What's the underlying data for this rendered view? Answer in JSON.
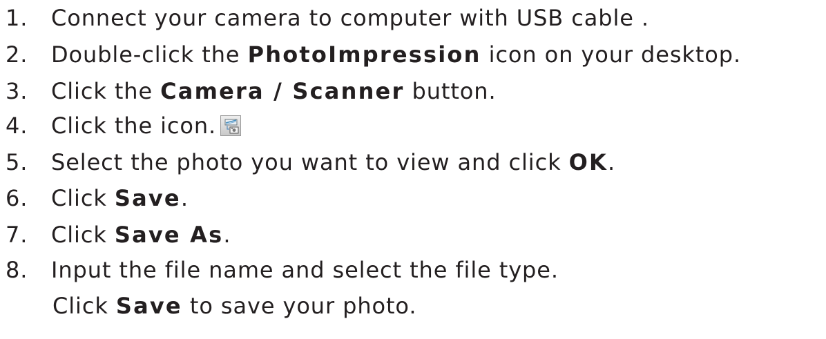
{
  "steps": [
    {
      "num": "1.",
      "text": "Connect your camera to computer with USB cable ."
    },
    {
      "num": "2.",
      "pre": "Double-click the ",
      "bold": "PhotoImpression",
      "post": " icon on your desktop."
    },
    {
      "num": "3.",
      "pre": "Click the ",
      "bold": "Camera / Scanner",
      "post": " button."
    },
    {
      "num": "4.",
      "text": "Click the icon.",
      "icon": "scanner-camera-icon"
    },
    {
      "num": "5.",
      "pre": "Select the photo you want to view and click ",
      "bold": "OK",
      "post": "."
    },
    {
      "num": "6.",
      "pre": "Click ",
      "bold": "Save",
      "post": "."
    },
    {
      "num": "7.",
      "pre": "Click ",
      "bold": "Save As",
      "post": "."
    },
    {
      "num": "8.",
      "text": "Input the file name and select the file type.",
      "cont_pre": "Click ",
      "cont_bold": "Save",
      "cont_post": " to save your photo."
    }
  ]
}
